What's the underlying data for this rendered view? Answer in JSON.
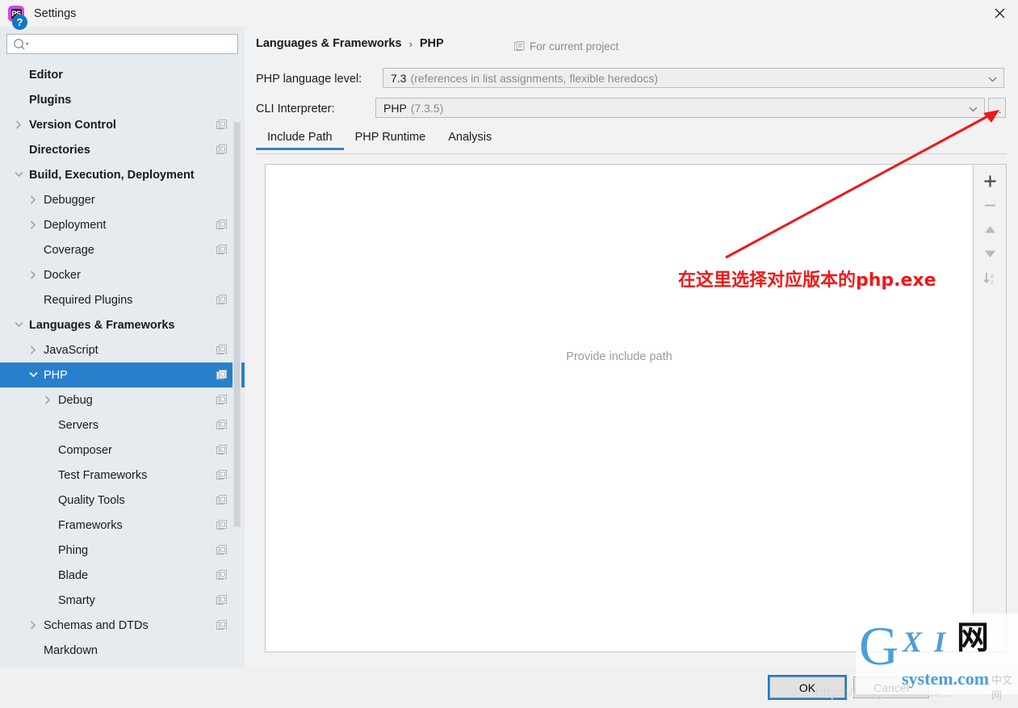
{
  "window": {
    "title": "Settings",
    "logo_icon": "phpstorm-ps-logo-icon",
    "close_icon": "close-icon"
  },
  "sidebar": {
    "search": {
      "placeholder": "",
      "value": "",
      "icon": "search-icon"
    },
    "items": [
      {
        "label": "Editor",
        "indent": 36,
        "arrow": "none",
        "bold": true,
        "copy": false,
        "selected": false
      },
      {
        "label": "Plugins",
        "indent": 36,
        "arrow": "none",
        "bold": true,
        "copy": false,
        "selected": false
      },
      {
        "label": "Version Control",
        "indent": 36,
        "arrow": "right",
        "bold": true,
        "copy": true,
        "selected": false
      },
      {
        "label": "Directories",
        "indent": 36,
        "arrow": "none",
        "bold": true,
        "copy": true,
        "selected": false
      },
      {
        "label": "Build, Execution, Deployment",
        "indent": 36,
        "arrow": "down",
        "bold": true,
        "copy": false,
        "selected": false
      },
      {
        "label": "Debugger",
        "indent": 54,
        "arrow": "right",
        "bold": false,
        "copy": false,
        "selected": false
      },
      {
        "label": "Deployment",
        "indent": 54,
        "arrow": "right",
        "bold": false,
        "copy": true,
        "selected": false
      },
      {
        "label": "Coverage",
        "indent": 54,
        "arrow": "none",
        "bold": false,
        "copy": true,
        "selected": false
      },
      {
        "label": "Docker",
        "indent": 54,
        "arrow": "right",
        "bold": false,
        "copy": false,
        "selected": false
      },
      {
        "label": "Required Plugins",
        "indent": 54,
        "arrow": "none",
        "bold": false,
        "copy": true,
        "selected": false
      },
      {
        "label": "Languages & Frameworks",
        "indent": 36,
        "arrow": "down",
        "bold": true,
        "copy": false,
        "selected": false
      },
      {
        "label": "JavaScript",
        "indent": 54,
        "arrow": "right",
        "bold": false,
        "copy": true,
        "selected": false
      },
      {
        "label": "PHP",
        "indent": 54,
        "arrow": "down",
        "bold": false,
        "copy": true,
        "selected": true
      },
      {
        "label": "Debug",
        "indent": 72,
        "arrow": "right",
        "bold": false,
        "copy": true,
        "selected": false
      },
      {
        "label": "Servers",
        "indent": 72,
        "arrow": "none",
        "bold": false,
        "copy": true,
        "selected": false
      },
      {
        "label": "Composer",
        "indent": 72,
        "arrow": "none",
        "bold": false,
        "copy": true,
        "selected": false
      },
      {
        "label": "Test Frameworks",
        "indent": 72,
        "arrow": "none",
        "bold": false,
        "copy": true,
        "selected": false
      },
      {
        "label": "Quality Tools",
        "indent": 72,
        "arrow": "none",
        "bold": false,
        "copy": true,
        "selected": false
      },
      {
        "label": "Frameworks",
        "indent": 72,
        "arrow": "none",
        "bold": false,
        "copy": true,
        "selected": false
      },
      {
        "label": "Phing",
        "indent": 72,
        "arrow": "none",
        "bold": false,
        "copy": true,
        "selected": false
      },
      {
        "label": "Blade",
        "indent": 72,
        "arrow": "none",
        "bold": false,
        "copy": true,
        "selected": false
      },
      {
        "label": "Smarty",
        "indent": 72,
        "arrow": "none",
        "bold": false,
        "copy": true,
        "selected": false
      },
      {
        "label": "Schemas and DTDs",
        "indent": 54,
        "arrow": "right",
        "bold": false,
        "copy": true,
        "selected": false
      },
      {
        "label": "Markdown",
        "indent": 54,
        "arrow": "none",
        "bold": false,
        "copy": false,
        "selected": false
      }
    ]
  },
  "main": {
    "breadcrumb": {
      "parent": "Languages & Frameworks",
      "separator": "›",
      "current": "PHP"
    },
    "scope_note": {
      "label": "For current project",
      "icon": "project-scope-icon"
    },
    "language_level": {
      "label": "PHP language level:",
      "value": "7.3",
      "hint": "(references in list assignments, flexible heredocs)"
    },
    "cli_interpreter": {
      "label": "CLI Interpreter:",
      "value": "PHP",
      "hint": "(7.3.5)",
      "browse_label": "..."
    },
    "tabs": [
      {
        "label": "Include Path",
        "active": true
      },
      {
        "label": "PHP Runtime",
        "active": false
      },
      {
        "label": "Analysis",
        "active": false
      }
    ],
    "content_placeholder": "Provide include path",
    "toolbar": [
      {
        "name": "add-button",
        "icon": "plus-icon",
        "enabled": true
      },
      {
        "name": "remove-button",
        "icon": "minus-icon",
        "enabled": false
      },
      {
        "name": "move-up-button",
        "icon": "arrow-up-icon",
        "enabled": false
      },
      {
        "name": "move-down-button",
        "icon": "arrow-down-icon",
        "enabled": false
      },
      {
        "name": "sort-button",
        "icon": "sort-az-icon",
        "enabled": false
      }
    ]
  },
  "footer": {
    "help_label": "?",
    "ok_label": "OK",
    "cancel_label": "Cancel"
  },
  "annotation": {
    "text": "在这里选择对应版本的php.exe",
    "color": "#f01818",
    "arrow_icon": "red-arrow-icon"
  },
  "watermark": {
    "g": "G",
    "xi": "X I",
    "wang": "网",
    "domain": "system.com",
    "sub": "中文网",
    "url": "https://blog.csdn.net/..."
  },
  "colors": {
    "accent": "#2880cc",
    "tab_active": "#3b7fc4",
    "sidebar_bg": "#e6ebef",
    "panel_bg": "#f2f2f2",
    "annotation_red": "#f01818"
  }
}
